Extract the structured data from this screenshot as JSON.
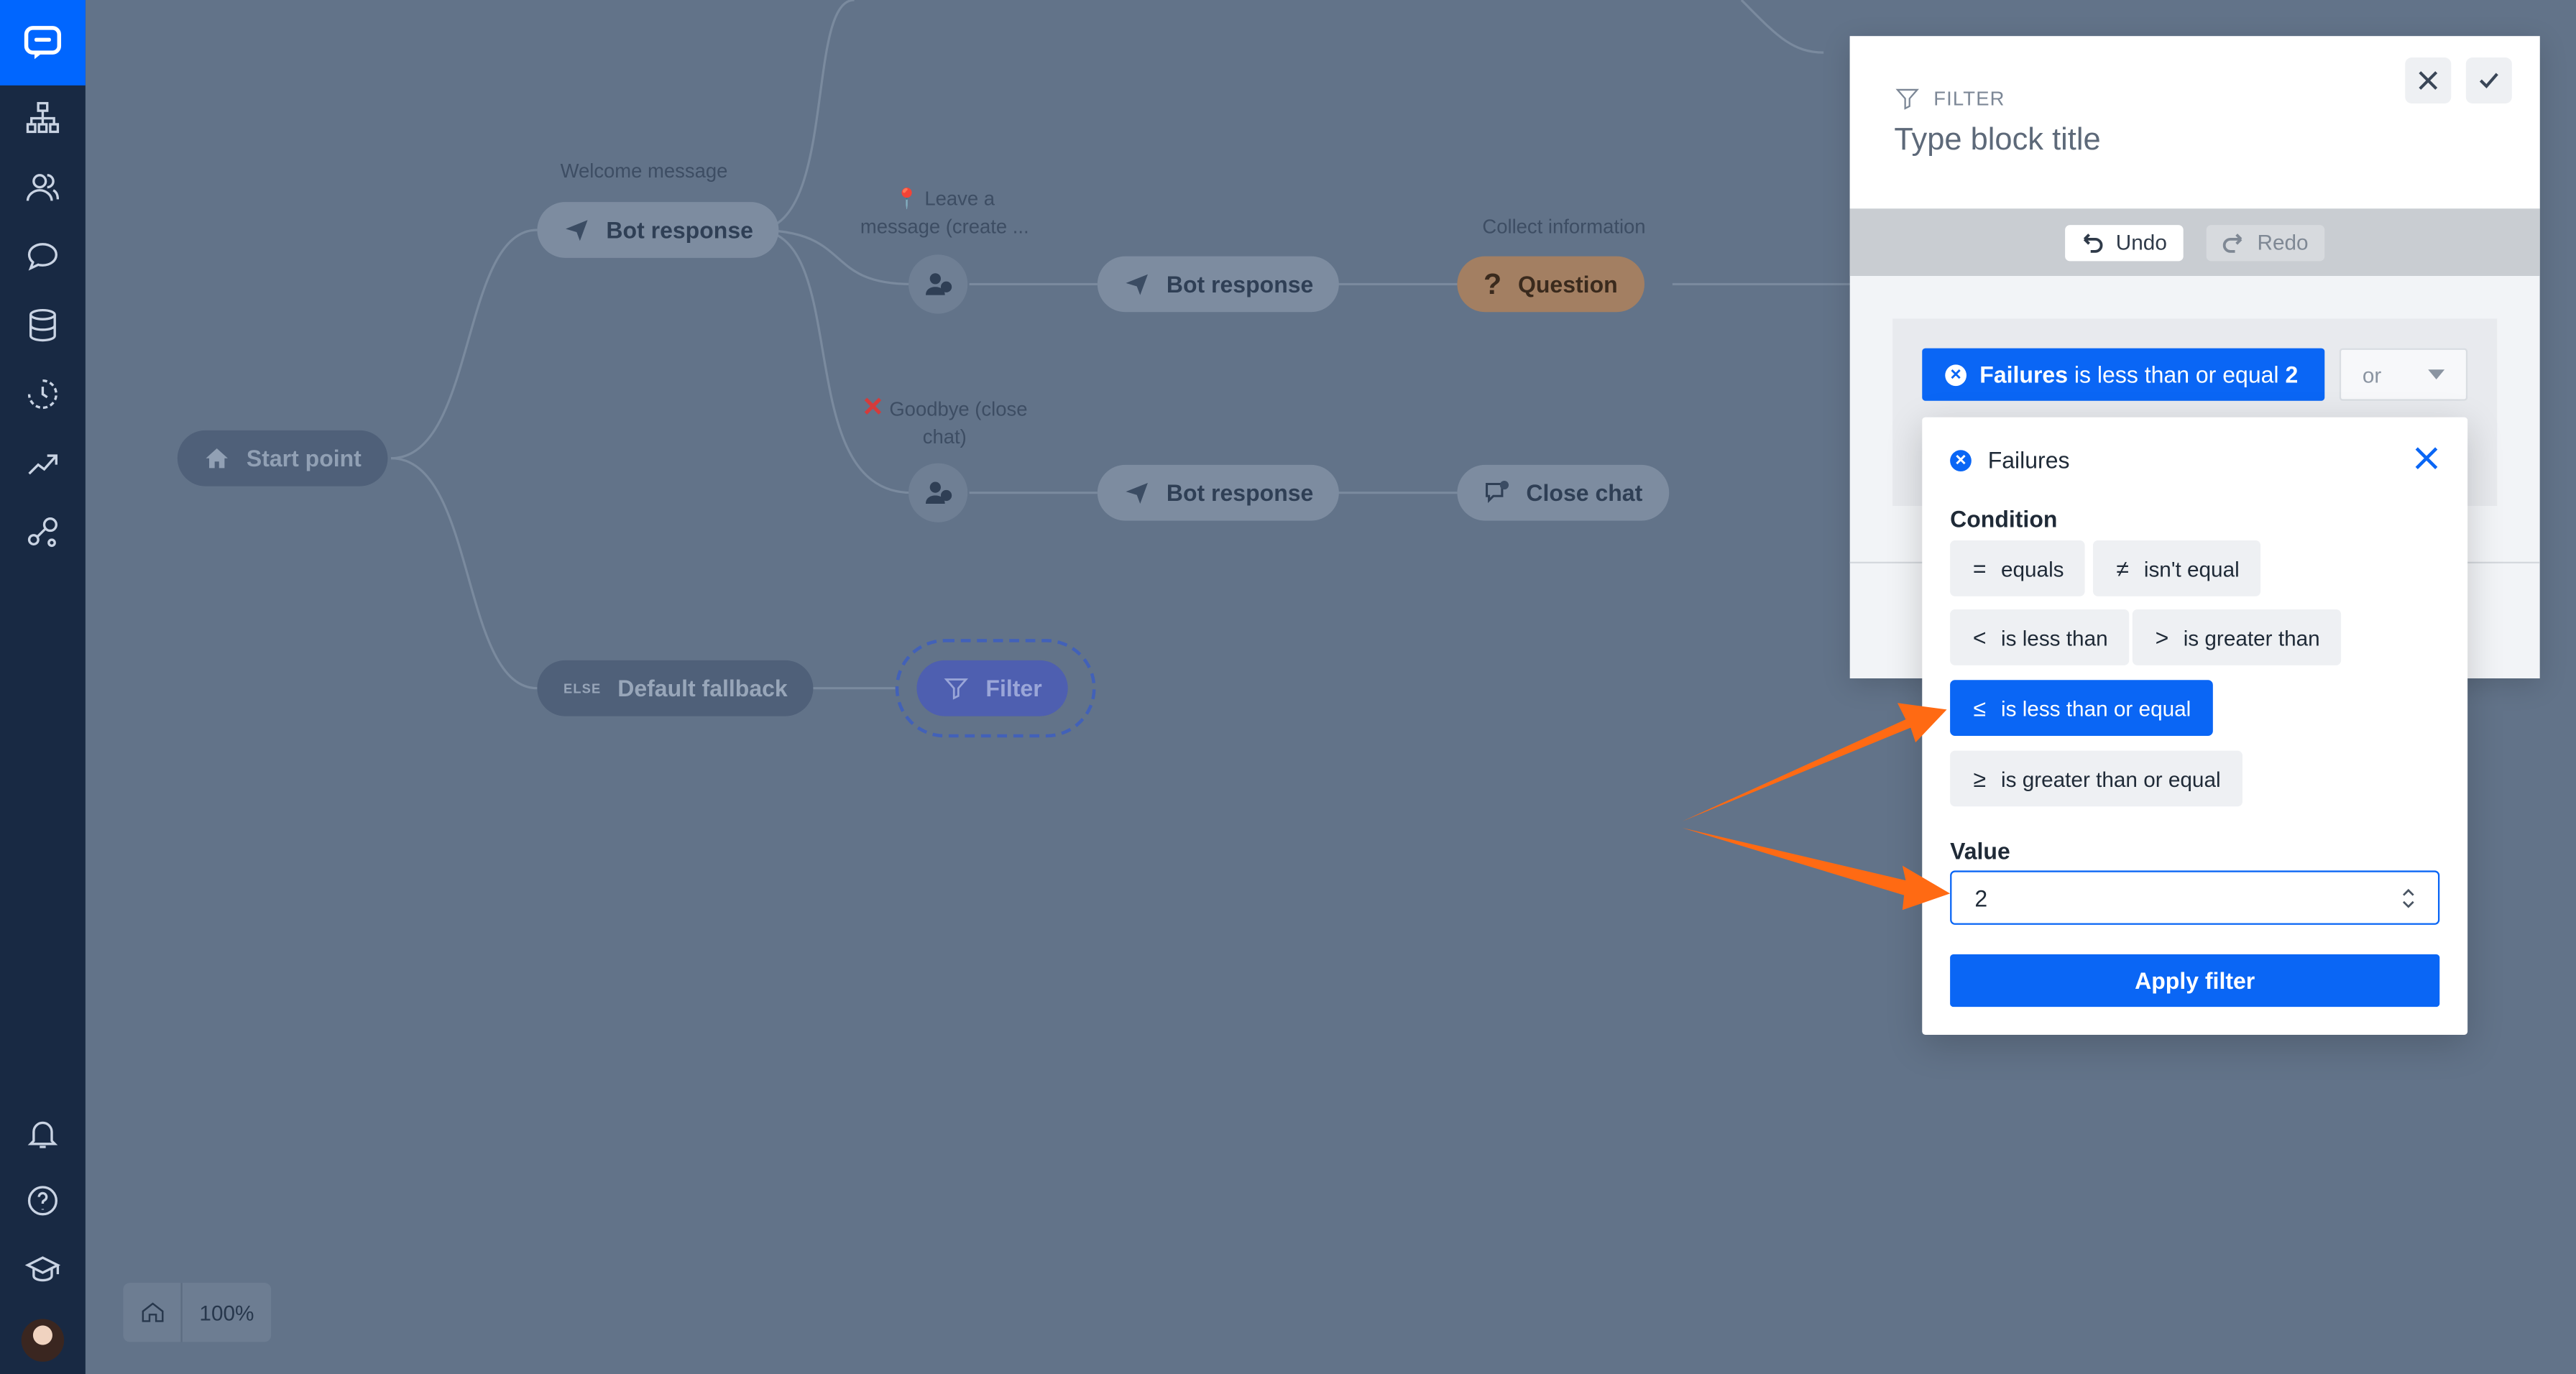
{
  "sidebar": {
    "icons": [
      "chat-logo-icon",
      "structure-icon",
      "users-icon",
      "chat-bubble-icon",
      "database-icon",
      "history-icon",
      "trend-icon",
      "integrations-icon",
      "bell-icon",
      "help-icon",
      "academy-icon"
    ]
  },
  "flow": {
    "start_label": "Start point",
    "welcome_caption": "Welcome message",
    "bot_response_1": "Bot response",
    "leave_message_caption": "Leave a message (create ...",
    "bot_response_2": "Bot response",
    "collect_caption": "Collect information",
    "question_label": "Question",
    "goodbye_caption": "Goodbye (close chat)",
    "bot_response_3": "Bot response",
    "close_chat_label": "Close chat",
    "fallback_badge": "ELSE",
    "fallback_label": "Default fallback",
    "filter_label": "Filter"
  },
  "zoom": {
    "value": "100%"
  },
  "panel": {
    "type_label": "FILTER",
    "title_placeholder": "Type block title",
    "undo_label": "Undo",
    "redo_label": "Redo"
  },
  "chip": {
    "field": "Failures",
    "operator": "is less than or equal",
    "value": "2"
  },
  "logic_select": {
    "selected": "or"
  },
  "popover": {
    "field_name": "Failures",
    "condition_label": "Condition",
    "conditions": [
      {
        "symbol": "=",
        "label": "equals",
        "active": false
      },
      {
        "symbol": "≠",
        "label": "isn't equal",
        "active": false
      },
      {
        "symbol": "<",
        "label": "is less than",
        "active": false
      },
      {
        "symbol": ">",
        "label": "is greater than",
        "active": false
      },
      {
        "symbol": "≤",
        "label": "is less than or equal",
        "active": true
      },
      {
        "symbol": "≥",
        "label": "is greater than or equal",
        "active": false
      }
    ],
    "value_label": "Value",
    "value": "2",
    "apply_label": "Apply filter"
  },
  "colors": {
    "accent": "#0a66f5",
    "sidebar_bg": "#182943",
    "annotation_arrow": "#ff6a13"
  }
}
